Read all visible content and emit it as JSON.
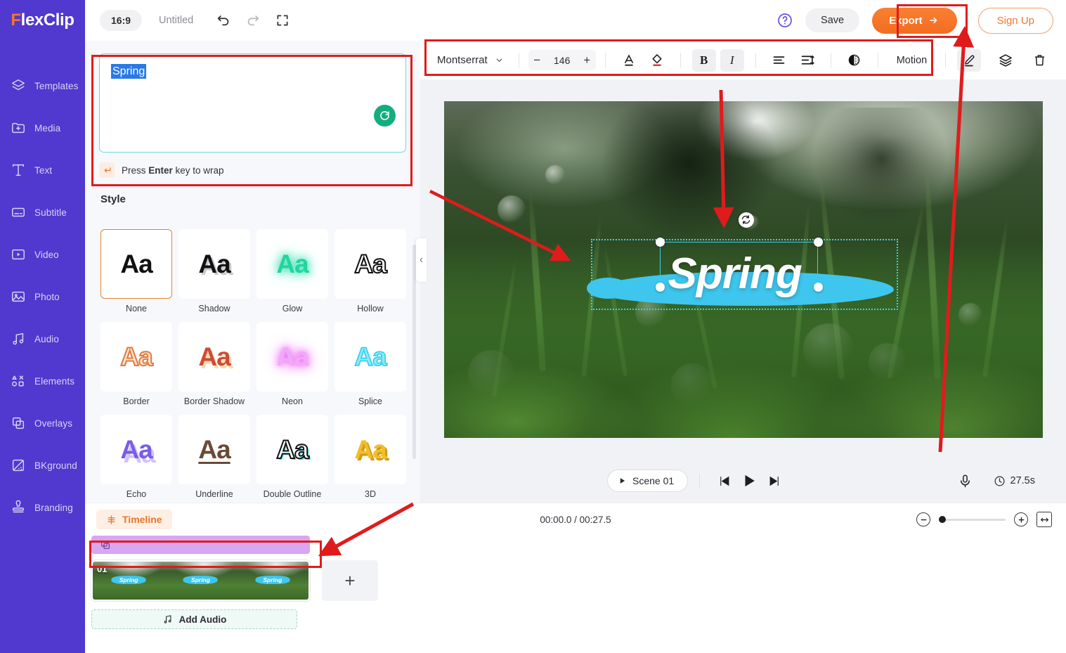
{
  "brand": {
    "name_f": "F",
    "name_rest": "lexClip"
  },
  "topbar": {
    "ratio": "16:9",
    "doc_title": "Untitled",
    "undo_icon": "undo-icon",
    "redo_icon": "redo-icon",
    "fullscreen_icon": "fullscreen-icon",
    "help_icon": "help-circle-icon",
    "save_label": "Save",
    "export_label": "Export",
    "signup_label": "Sign Up",
    "export_color": "#F3701F",
    "signup_color": "#F2762E"
  },
  "sidebar": {
    "items": [
      {
        "label": "Templates",
        "icon": "layers-icon"
      },
      {
        "label": "Media",
        "icon": "folder-plus-icon"
      },
      {
        "label": "Text",
        "icon": "text-t-icon"
      },
      {
        "label": "Subtitle",
        "icon": "subtitle-icon"
      },
      {
        "label": "Video",
        "icon": "video-play-icon"
      },
      {
        "label": "Photo",
        "icon": "photo-icon"
      },
      {
        "label": "Audio",
        "icon": "music-note-icon"
      },
      {
        "label": "Elements",
        "icon": "shapes-icon"
      },
      {
        "label": "Overlays",
        "icon": "overlays-icon"
      },
      {
        "label": "BKground",
        "icon": "background-icon"
      },
      {
        "label": "Branding",
        "icon": "stamp-icon"
      }
    ]
  },
  "text_panel": {
    "value": "Spring",
    "refresh_icon": "refresh-icon",
    "hint_prefix": "Press ",
    "hint_key": "Enter",
    "hint_suffix": " key to wrap",
    "enter_icon": "enter-arrow-icon",
    "style_heading": "Style",
    "styles": [
      {
        "label": "None",
        "sample": "Aa",
        "cls": "s-none",
        "active": true
      },
      {
        "label": "Shadow",
        "sample": "Aa",
        "cls": "s-shadow",
        "active": false
      },
      {
        "label": "Glow",
        "sample": "Aa",
        "cls": "s-glow",
        "active": false
      },
      {
        "label": "Hollow",
        "sample": "Aa",
        "cls": "s-hollow",
        "active": false
      },
      {
        "label": "Border",
        "sample": "Aa",
        "cls": "s-border",
        "active": false
      },
      {
        "label": "Border Shadow",
        "sample": "Aa",
        "cls": "s-bordershadow",
        "active": false
      },
      {
        "label": "Neon",
        "sample": "Aa",
        "cls": "s-neon",
        "active": false
      },
      {
        "label": "Splice",
        "sample": "Aa",
        "cls": "s-splice",
        "active": false
      },
      {
        "label": "Echo",
        "sample": "Aa",
        "cls": "s-echo",
        "active": false
      },
      {
        "label": "Underline",
        "sample": "Aa",
        "cls": "s-underline",
        "active": false
      },
      {
        "label": "Double Outline",
        "sample": "Aa",
        "cls": "s-doubleoutline",
        "active": false
      },
      {
        "label": "3D",
        "sample": "Aa",
        "cls": "s-3d",
        "active": false
      }
    ]
  },
  "text_toolbar": {
    "font_family": "Montserrat",
    "font_size": "146",
    "minus_label": "−",
    "plus_label": "+",
    "font_color_icon": "font-color-a-icon",
    "fill_color_icon": "paint-bucket-icon",
    "bold_icon": "bold-icon",
    "bold_label": "B",
    "italic_icon": "italic-icon",
    "italic_label": "I",
    "align_icon": "align-left-icon",
    "spacing_icon": "line-spacing-icon",
    "opacity_icon": "opacity-icon",
    "motion_label": "Motion",
    "edit_icon": "pen-edit-icon",
    "layers_icon": "layers-stack-icon",
    "delete_icon": "trash-icon"
  },
  "canvas": {
    "text_element": "Spring",
    "highlight_color": "#3EC6EE",
    "selection_color": "#3FD0E6",
    "rotate_icon": "rotate-icon"
  },
  "player": {
    "scene_label": "Scene 01",
    "scene_play_icon": "play-small-icon",
    "prev_icon": "skip-previous-icon",
    "play_icon": "play-icon",
    "next_icon": "skip-next-icon",
    "mic_icon": "microphone-icon",
    "clock_icon": "clock-icon",
    "duration": "27.5s"
  },
  "timeline": {
    "tab_label": "Timeline",
    "tab_icon": "timeline-icon",
    "time_display": "00:00.0 / 00:27.5",
    "zoom_out_icon": "zoom-out-icon",
    "zoom_in_icon": "zoom-in-icon",
    "fit_icon": "fit-width-icon",
    "overlay_track_icon": "overlays-icon",
    "clip_number": "01",
    "clip_thumb_label": "Spring",
    "add_clip_label": "+",
    "add_audio_label": "Add Audio",
    "add_audio_icon": "music-note-icon",
    "overlay_color": "#D9A6F2"
  },
  "annotations": {
    "highlight_color": "#E01B1B",
    "boxes": [
      "text-input-panel",
      "text-toolbar",
      "export-button",
      "overlay-track"
    ],
    "arrows": [
      "to-canvas-text",
      "to-export-button",
      "to-canvas-left",
      "to-overlay-track"
    ]
  }
}
